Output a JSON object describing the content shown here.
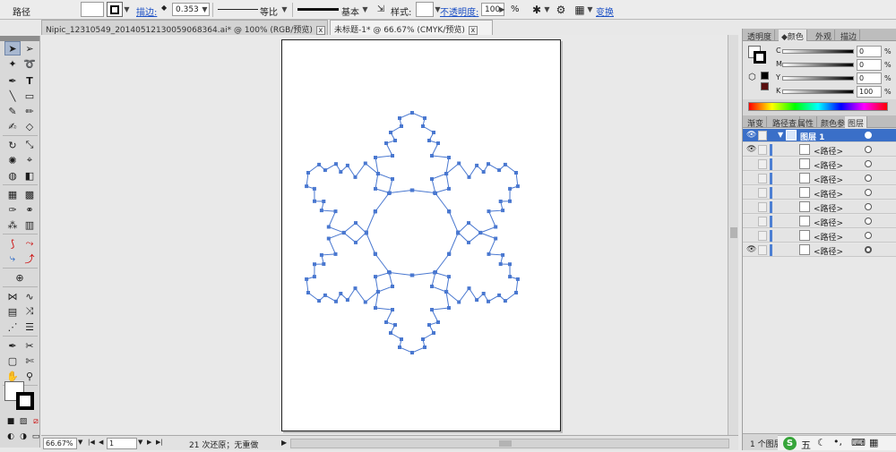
{
  "control_bar": {
    "object_type": "路径",
    "stroke_link": "描边:",
    "stroke_weight": "0.353",
    "profile_label": "等比",
    "brush_label": "基本",
    "style_label": "样式:",
    "opacity_link": "不透明度:",
    "opacity_value": "100",
    "opacity_unit": "%",
    "transform_link": "变换"
  },
  "doc_tabs": [
    {
      "label": "Nipic_12310549_20140512130059068364.ai* @ 100% (RGB/预览)",
      "close": "x"
    },
    {
      "label": "未标题-1* @ 66.67% (CMYK/预览)",
      "close": "x"
    }
  ],
  "status_bar": {
    "zoom": "66.67%",
    "page": "1",
    "undo_text": "21 次还原；无重做"
  },
  "color_panel": {
    "tabs": [
      "透明度",
      "颜色",
      "外观",
      "描边"
    ],
    "channels": [
      {
        "label": "C",
        "value": "0",
        "unit": "%"
      },
      {
        "label": "M",
        "value": "0",
        "unit": "%"
      },
      {
        "label": "Y",
        "value": "0",
        "unit": "%"
      },
      {
        "label": "K",
        "value": "100",
        "unit": "%"
      }
    ]
  },
  "layers_panel": {
    "tabs": [
      "渐变",
      "路径查",
      "属性",
      "颜色参",
      "图层"
    ],
    "top_layer": "图层 1",
    "items": [
      "<路径>",
      "<路径>",
      "<路径>",
      "<路径>",
      "<路径>",
      "<路径>",
      "<路径>",
      "<路径>"
    ],
    "footer": "1 个图层"
  },
  "tray": {
    "ime": "五",
    "icons": [
      "moon-icon",
      "punct-icon",
      "keyboard-icon",
      "grid-icon"
    ]
  },
  "snowflake_color": "#4a78d0",
  "accent": "#3a6fc8"
}
